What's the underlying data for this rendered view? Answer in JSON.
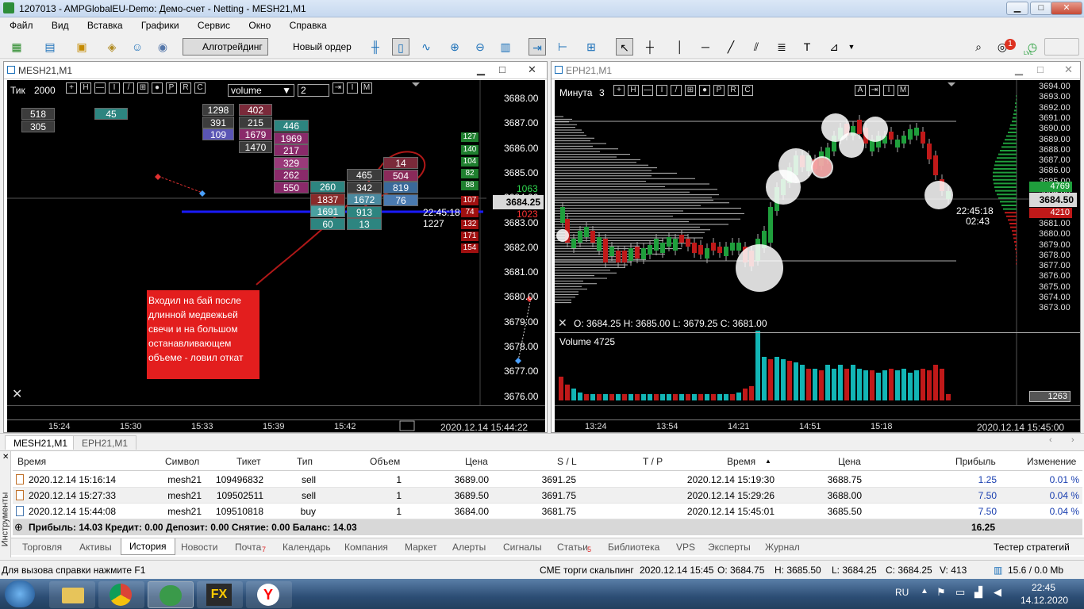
{
  "window": {
    "title": "1207013 - AMPGlobalEU-Demo: Демо-счет - Netting - MESH21,M1",
    "btn_min": "▁",
    "btn_max": "□",
    "btn_close": "✕"
  },
  "menu": [
    "Файл",
    "Вид",
    "Вставка",
    "Графики",
    "Сервис",
    "Окно",
    "Справка"
  ],
  "toolbar": {
    "algo": "Алготрейдинг",
    "new_order": "Новый ордер",
    "notif_count": "1",
    "lvl": "LVL"
  },
  "chart1": {
    "title": "MESH21,M1",
    "ctrl_tick": "Тик",
    "ctrl_tick_val": "2000",
    "ctrl_btns": [
      "+",
      "H",
      "—",
      "I",
      "/",
      "⊞",
      "●",
      "P",
      "R",
      "C"
    ],
    "volume_select": "volume",
    "num_field": "2",
    "price_labels": [
      "3688.00",
      "3687.00",
      "3686.00",
      "3685.00",
      "3684.00",
      "3683.00",
      "3682.00",
      "3681.00",
      "3680.00",
      "3679.00",
      "3678.00",
      "3677.00",
      "3676.00"
    ],
    "current_price": "3684.25",
    "time_marker": "22:45:18",
    "time_count": "1227",
    "green_tags": [
      "127",
      "140",
      "104",
      "82",
      "88",
      "1063"
    ],
    "red_tags": [
      "107",
      "74",
      "1023",
      "132",
      "171",
      "154"
    ],
    "time_labels": [
      "15:24",
      "15:30",
      "15:33",
      "15:39",
      "15:42"
    ],
    "date_label": "2020.12.14 15:44:22",
    "fp_col1": [
      "518",
      "305"
    ],
    "fp_col2": [
      "45"
    ],
    "fp_col3": [
      "1298",
      "391",
      "109"
    ],
    "fp_col4": [
      "402",
      "215",
      "1679",
      "1470"
    ],
    "fp_col5": [
      "446",
      "1969",
      "217",
      "329",
      "262",
      "550"
    ],
    "fp_col6": [
      "260",
      "1837",
      "1691",
      "60"
    ],
    "fp_col7": [
      "465",
      "342",
      "1672",
      "913",
      "13"
    ],
    "fp_col8": [
      "14",
      "504",
      "819",
      "76"
    ],
    "annotation": "Входил на бай после длинной медвежьей свечи и на большом останавливающем объеме - ловил откат"
  },
  "chart2": {
    "title": "EPH21,M1",
    "ctrl_label": "Минута",
    "ctrl_val": "3",
    "ctrl_btns": [
      "+",
      "H",
      "—",
      "I",
      "/",
      "⊞",
      "●",
      "P",
      "R",
      "C"
    ],
    "ctrl_right": [
      "A",
      "⇥",
      "I",
      "M"
    ],
    "price_labels": [
      "3694.00",
      "3693.00",
      "3692.00",
      "3691.00",
      "3690.00",
      "3689.00",
      "3688.00",
      "3687.00",
      "3686.00",
      "3685.00",
      "3684.00",
      "3683.00",
      "3682.00",
      "3681.00",
      "3680.00",
      "3679.00",
      "3678.00",
      "3677.00",
      "3676.00",
      "3675.00",
      "3674.00",
      "3673.00"
    ],
    "green_tag": "4769",
    "current_price": "3684.50",
    "red_tag": "4210",
    "time1": "22:45:18",
    "time2": "02:43",
    "ohlc": "O: 3684.25  H: 3685.00  L: 3679.25  C: 3681.00",
    "volume_label": "Volume 4725",
    "volume_value": "1263",
    "time_labels": [
      "13:24",
      "13:54",
      "14:21",
      "14:51",
      "15:18"
    ],
    "date_label": "2020.12.14 15:45:00"
  },
  "chart_tabs": [
    "MESH21,M1",
    "EPH21,M1"
  ],
  "terminal": {
    "side_label": "Инструменты",
    "headers": [
      "Время",
      "Символ",
      "Тикет",
      "Тип",
      "Объем",
      "Цена",
      "S / L",
      "T / P",
      "Время",
      "Цена",
      "Прибыль",
      "Изменение"
    ],
    "rows": [
      [
        "2020.12.14 15:16:14",
        "mesh21",
        "109496832",
        "sell",
        "1",
        "3689.00",
        "3691.25",
        "",
        "2020.12.14 15:19:30",
        "3688.75",
        "1.25",
        "0.01 %"
      ],
      [
        "2020.12.14 15:27:33",
        "mesh21",
        "109502511",
        "sell",
        "1",
        "3689.50",
        "3691.75",
        "",
        "2020.12.14 15:29:26",
        "3688.00",
        "7.50",
        "0.04 %"
      ],
      [
        "2020.12.14 15:44:08",
        "mesh21",
        "109510818",
        "buy",
        "1",
        "3684.00",
        "3681.75",
        "",
        "2020.12.14 15:45:01",
        "3685.50",
        "7.50",
        "0.04 %"
      ]
    ],
    "summary": "Прибыль: 14.03  Кредит: 0.00  Депозит: 0.00  Снятие: 0.00  Баланс: 14.03",
    "summary_total": "16.25",
    "tabs": [
      "Торговля",
      "Активы",
      "История",
      "Новости",
      "Почта",
      "Календарь",
      "Компания",
      "Маркет",
      "Алерты",
      "Сигналы",
      "Статьи",
      "Библиотека",
      "VPS",
      "Эксперты",
      "Журнал"
    ],
    "tab_badge_mail": "7",
    "tab_badge_articles": "5",
    "tester": "Тестер стратегий"
  },
  "status": {
    "help": "Для вызова справки нажмите F1",
    "profile": "CME торги скальпинг",
    "time": "2020.12.14 15:45",
    "o": "O: 3684.75",
    "h": "H: 3685.50",
    "l": "L: 3684.25",
    "c": "C: 3684.25",
    "v": "V: 413",
    "conn": "15.6 / 0.0 Mb"
  },
  "taskbar": {
    "lang": "RU",
    "time": "22:45",
    "date": "14.12.2020"
  },
  "colors": {
    "buy_green": "#1f9f3c",
    "sell_red": "#c01919",
    "cyan_vol": "#12b5b5",
    "annotation_bg": "#e31e1e"
  }
}
